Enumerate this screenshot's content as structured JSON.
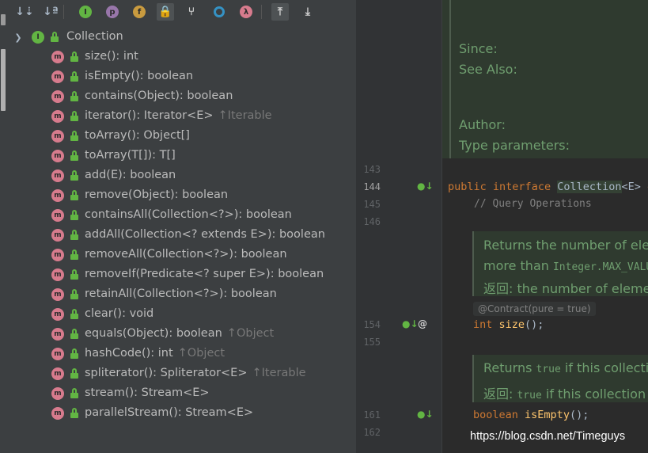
{
  "toolbar": {
    "buttons": [
      {
        "name": "sort-by-visibility-button",
        "glyph": "↓⇣",
        "color": "#a9b7c6"
      },
      {
        "name": "sort-alphabetically-button",
        "glyph": "↓ª",
        "color": "#a9b7c6"
      },
      {
        "name": "show-inherited-button",
        "glyph": "I",
        "color": "#62b543"
      },
      {
        "name": "show-properties-button",
        "glyph": "p",
        "color": "#9876aa"
      },
      {
        "name": "show-fields-button",
        "glyph": "f",
        "color": "#c99b3f"
      },
      {
        "name": "show-non-public-button",
        "glyph": "🔒",
        "color": "#e5573a"
      },
      {
        "name": "show-anonymous-button",
        "glyph": "⑂",
        "color": "#cfcfcf"
      },
      {
        "name": "show-lambdas-button",
        "glyph": "●",
        "color": "#3592c4"
      },
      {
        "name": "show-lambda-button",
        "glyph": "λ",
        "color": "#d77b8d"
      },
      {
        "name": "autoscroll-to-source-button",
        "glyph": "⤒",
        "color": "#cfcfcf"
      },
      {
        "name": "autoscroll-from-source-button",
        "glyph": "⤓",
        "color": "#cfcfcf"
      }
    ]
  },
  "tree": {
    "root": {
      "label": "Collection",
      "icon": "interface-icon"
    },
    "members": [
      {
        "name": "size(): int",
        "inherited": ""
      },
      {
        "name": "isEmpty(): boolean",
        "inherited": ""
      },
      {
        "name": "contains(Object): boolean",
        "inherited": ""
      },
      {
        "name": "iterator(): Iterator<E>",
        "inherited": "↑Iterable"
      },
      {
        "name": "toArray(): Object[]",
        "inherited": ""
      },
      {
        "name": "toArray(T[]): T[]",
        "inherited": ""
      },
      {
        "name": "add(E): boolean",
        "inherited": ""
      },
      {
        "name": "remove(Object): boolean",
        "inherited": ""
      },
      {
        "name": "containsAll(Collection<?>): boolean",
        "inherited": ""
      },
      {
        "name": "addAll(Collection<? extends E>): boolean",
        "inherited": ""
      },
      {
        "name": "removeAll(Collection<?>): boolean",
        "inherited": ""
      },
      {
        "name": "removeIf(Predicate<? super E>): boolean",
        "inherited": ""
      },
      {
        "name": "retainAll(Collection<?>): boolean",
        "inherited": ""
      },
      {
        "name": "clear(): void",
        "inherited": ""
      },
      {
        "name": "equals(Object): boolean",
        "inherited": "↑Object"
      },
      {
        "name": "hashCode(): int",
        "inherited": "↑Object"
      },
      {
        "name": "spliterator(): Spliterator<E>",
        "inherited": "↑Iterable"
      },
      {
        "name": "stream(): Stream<E>",
        "inherited": ""
      },
      {
        "name": "parallelStream(): Stream<E>",
        "inherited": ""
      }
    ],
    "member_icon_letter": "m",
    "root_icon_letter": "I"
  },
  "editor": {
    "doc_header": {
      "since": "Since:",
      "see_also": "See Also:",
      "author": "Author:",
      "type_parameters": "Type parameters:"
    },
    "line_numbers": {
      "l143": "143",
      "l144": "144",
      "l145": "145",
      "l146": "146",
      "l154": "154",
      "l155": "155",
      "l161": "161",
      "l162": "162"
    },
    "code": {
      "public": "public",
      "interface": "interface",
      "class_name": "Collection",
      "generic": "<E>",
      "extends_partial": "e",
      "comment_query_ops": "// Query Operations",
      "int_kw": "int",
      "size_fn": "size",
      "parens_semi": "();",
      "boolean_kw": "boolean",
      "isempty_fn": "isEmpty"
    },
    "doc_size": {
      "line1": "Returns the number of elem",
      "line2_text": "more than ",
      "line2_code": "Integer.MAX_VALU",
      "line3_label": "返回: ",
      "line3_text": "the number of elemen"
    },
    "annotation": "@Contract(pure = true)",
    "doc_isempty": {
      "line1_text": "Returns ",
      "line1_code": "true",
      "line1_rest": " if this collectio",
      "line2_label": "返回: ",
      "line2_code": "true",
      "line2_rest": " if this collection c"
    },
    "gutter_at": "@"
  },
  "watermark": "https://blog.csdn.net/Timeguys",
  "colors": {
    "panel_bg": "#3c3f41",
    "editor_bg": "#2b2b2b",
    "doc_bg": "#2f3a2f",
    "doc_text": "#6f9e6f",
    "method_icon": "#d77b8d",
    "interface_icon": "#62b543",
    "keyword": "#cc7832",
    "function": "#ffc66d"
  }
}
